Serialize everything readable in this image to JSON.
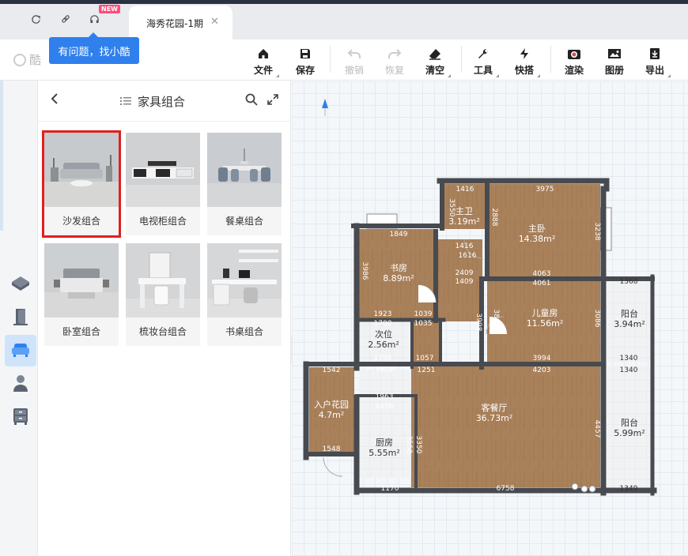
{
  "tabs": {
    "badge": "NEW",
    "document_tab": "海秀花园-1期",
    "tooltip": "有问题，找小酷"
  },
  "toolbar": {
    "logo_text": "酷",
    "items": [
      {
        "label": "文件",
        "icon": "home-icon",
        "disabled": false
      },
      {
        "label": "保存",
        "icon": "save-icon",
        "disabled": false
      },
      {
        "label": "撤销",
        "icon": "undo-icon",
        "disabled": true
      },
      {
        "label": "恢复",
        "icon": "redo-icon",
        "disabled": true
      },
      {
        "label": "清空",
        "icon": "eraser-icon",
        "disabled": false
      },
      {
        "label": "工具",
        "icon": "wrench-icon",
        "disabled": false
      },
      {
        "label": "快搭",
        "icon": "lightning-icon",
        "disabled": false
      },
      {
        "label": "渲染",
        "icon": "camera-icon",
        "disabled": false
      },
      {
        "label": "图册",
        "icon": "picture-icon",
        "disabled": false
      },
      {
        "label": "导出",
        "icon": "export-icon",
        "disabled": false
      }
    ]
  },
  "panel": {
    "title": "家具组合",
    "cards": [
      {
        "name": "沙发组合",
        "selected": true
      },
      {
        "name": "电视柜组合",
        "selected": false
      },
      {
        "name": "餐桌组合",
        "selected": false
      },
      {
        "name": "卧室组合",
        "selected": false
      },
      {
        "name": "梳妆台组合",
        "selected": false
      },
      {
        "name": "书桌组合",
        "selected": false
      }
    ]
  },
  "floorplan": {
    "rooms": [
      {
        "name": "主卫",
        "area": "3.19m²"
      },
      {
        "name": "主卧",
        "area": "14.38m²"
      },
      {
        "name": "书房",
        "area": "8.89m²"
      },
      {
        "name": "儿童房",
        "area": "11.56m²"
      },
      {
        "name": "阳台",
        "area": "3.94m²"
      },
      {
        "name": "次位",
        "area": "2.56m²"
      },
      {
        "name": "入户花园",
        "area": "4.7m²"
      },
      {
        "name": "客餐厅",
        "area": "36.73m²"
      },
      {
        "name": "厨房",
        "area": "5.55m²"
      },
      {
        "name": "阳台",
        "area": "5.99m²"
      }
    ],
    "dimensions": [
      "1416",
      "3975",
      "3550",
      "2888",
      "3238",
      "1849",
      "1416",
      "1616",
      "2409",
      "4063",
      "1368",
      "1409",
      "4061",
      "3986",
      "1923",
      "1039",
      "1708",
      "1035",
      "3998",
      "3884",
      "3086",
      "1789",
      "1057",
      "3994",
      "1340",
      "1542",
      "1802",
      "1251",
      "4203",
      "1340",
      "1963",
      "1856",
      "4457",
      "1548",
      "3550",
      "3350",
      "1170",
      "6758",
      "1349"
    ]
  },
  "colors": {
    "accent": "#2f80ed",
    "wall": "#4a4a4a",
    "wood": "#a9805a",
    "tile": "#eef0f2",
    "highlight": "#e02020"
  }
}
